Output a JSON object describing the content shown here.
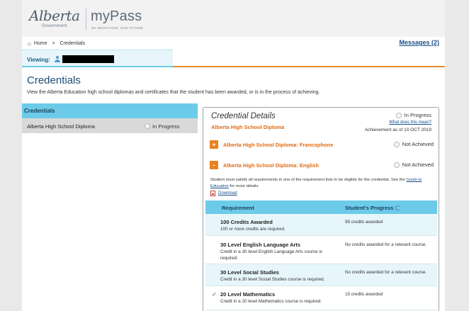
{
  "header": {
    "logo_alberta": "Alberta",
    "logo_government": "Government",
    "logo_app": "myPass",
    "logo_tagline": "MY EDUCATION, OUR FUTURE"
  },
  "breadcrumb": {
    "home": "Home",
    "separator": ">",
    "current": "Credentials"
  },
  "messages": {
    "label": "Messages (2)"
  },
  "viewing": {
    "label": "Viewing:"
  },
  "page": {
    "title": "Credentials",
    "description": "View the Alberta Education high school diplomas and certificates that the student has been awarded, or is in the process of achieving."
  },
  "left_panel": {
    "heading": "Credentials",
    "items": [
      {
        "name": "Alberta High School Diploma",
        "status": "In Progress"
      }
    ]
  },
  "details": {
    "title": "Credential Details",
    "credential": "Alberta High School Diploma",
    "status": "In Progress",
    "help_link": "What does this mean?",
    "achievement": "Achievement as of 10 OCT 2019",
    "sub_credentials": [
      {
        "toggle": "+",
        "name": "Alberta High School Diploma: Francophone",
        "status": "Not Achieved"
      },
      {
        "toggle": "-",
        "name": "Alberta High School Diploma: English",
        "status": "Not Achieved"
      }
    ],
    "note_prefix": "Student must satisfy all requirements in one of the requirement lists to be eligible for the credential. See the ",
    "note_link": "Guide to Education",
    "note_suffix": " for more details.",
    "download": "Download",
    "table": {
      "headers": [
        "Requirement",
        "Student's Progress"
      ],
      "rows": [
        {
          "check": "",
          "title": "100 Credits Awarded",
          "desc": "100 or more credits are required.",
          "progress": "99 credits awarded"
        },
        {
          "check": "",
          "title": "30 Level English Language Arts",
          "desc": "Credit in a 30 level English Language Arts course is required.",
          "progress": "No credits awarded for a relevant course."
        },
        {
          "check": "",
          "title": "30 Level Social Studies",
          "desc": "Credit in a 30 level Social Studies course is required.",
          "progress": "No credits awarded for a relevant course."
        },
        {
          "check": "✓",
          "title": "20 Level Mathematics",
          "desc": "Credit in a 20 level Mathematics course is required.",
          "progress": "15 credits awarded"
        }
      ]
    }
  },
  "colors": {
    "accent_blue": "#6ccbe8",
    "accent_orange": "#e68a2e",
    "link_blue": "#1a4f8a",
    "title_blue": "#1c4d78"
  }
}
